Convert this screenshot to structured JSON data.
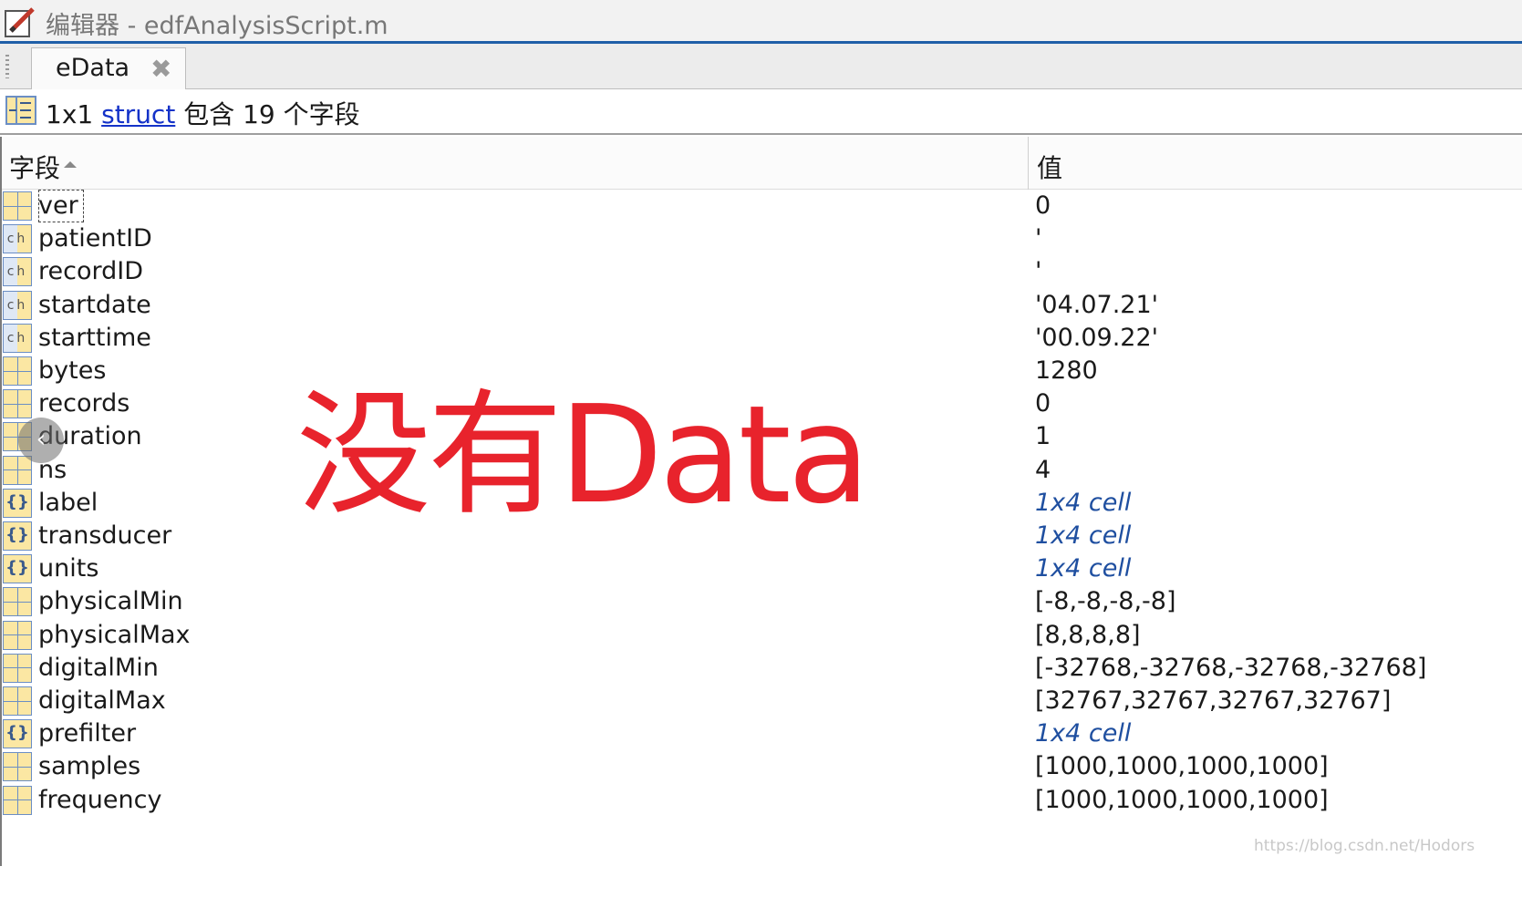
{
  "window": {
    "title": "编辑器 - edfAnalysisScript.m"
  },
  "tab": {
    "label": "eData",
    "close_glyph": "✖"
  },
  "struct_info": {
    "size": "1x1",
    "class_link": "struct",
    "suffix": "包含 19 个字段"
  },
  "table": {
    "col_field": "字段",
    "col_value": "值",
    "rows": [
      {
        "name": "ver",
        "value": "0",
        "icon": "matrix-icon"
      },
      {
        "name": "patientID",
        "value": "'",
        "icon": "char-icon"
      },
      {
        "name": "recordID",
        "value": "'",
        "icon": "char-icon"
      },
      {
        "name": "startdate",
        "value": "'04.07.21'",
        "icon": "char-icon"
      },
      {
        "name": "starttime",
        "value": "'00.09.22'",
        "icon": "char-icon"
      },
      {
        "name": "bytes",
        "value": "1280",
        "icon": "matrix-icon"
      },
      {
        "name": "records",
        "value": "0",
        "icon": "matrix-icon"
      },
      {
        "name": "duration",
        "value": "1",
        "icon": "matrix-icon"
      },
      {
        "name": "ns",
        "value": "4",
        "icon": "matrix-icon"
      },
      {
        "name": "label",
        "value": "1x4 cell",
        "icon": "cell-icon"
      },
      {
        "name": "transducer",
        "value": "1x4 cell",
        "icon": "cell-icon"
      },
      {
        "name": "units",
        "value": "1x4 cell",
        "icon": "cell-icon"
      },
      {
        "name": "physicalMin",
        "value": "[-8,-8,-8,-8]",
        "icon": "matrix-icon"
      },
      {
        "name": "physicalMax",
        "value": "[8,8,8,8]",
        "icon": "matrix-icon"
      },
      {
        "name": "digitalMin",
        "value": "[-32768,-32768,-32768,-32768]",
        "icon": "matrix-icon"
      },
      {
        "name": "digitalMax",
        "value": "[32767,32767,32767,32767]",
        "icon": "matrix-icon"
      },
      {
        "name": "prefilter",
        "value": "1x4 cell",
        "icon": "cell-icon"
      },
      {
        "name": "samples",
        "value": "[1000,1000,1000,1000]",
        "icon": "matrix-icon"
      },
      {
        "name": "frequency",
        "value": "[1000,1000,1000,1000]",
        "icon": "matrix-icon"
      }
    ]
  },
  "overlay": {
    "text": "没有Data",
    "color": "#e8232c"
  },
  "nav": {
    "glyph": "‹"
  },
  "watermark": "https://blog.csdn.net/Hodors",
  "colors": {
    "accent": "#1f5fa8",
    "link": "#1432c8",
    "cell_value": "#1f4fa0"
  }
}
